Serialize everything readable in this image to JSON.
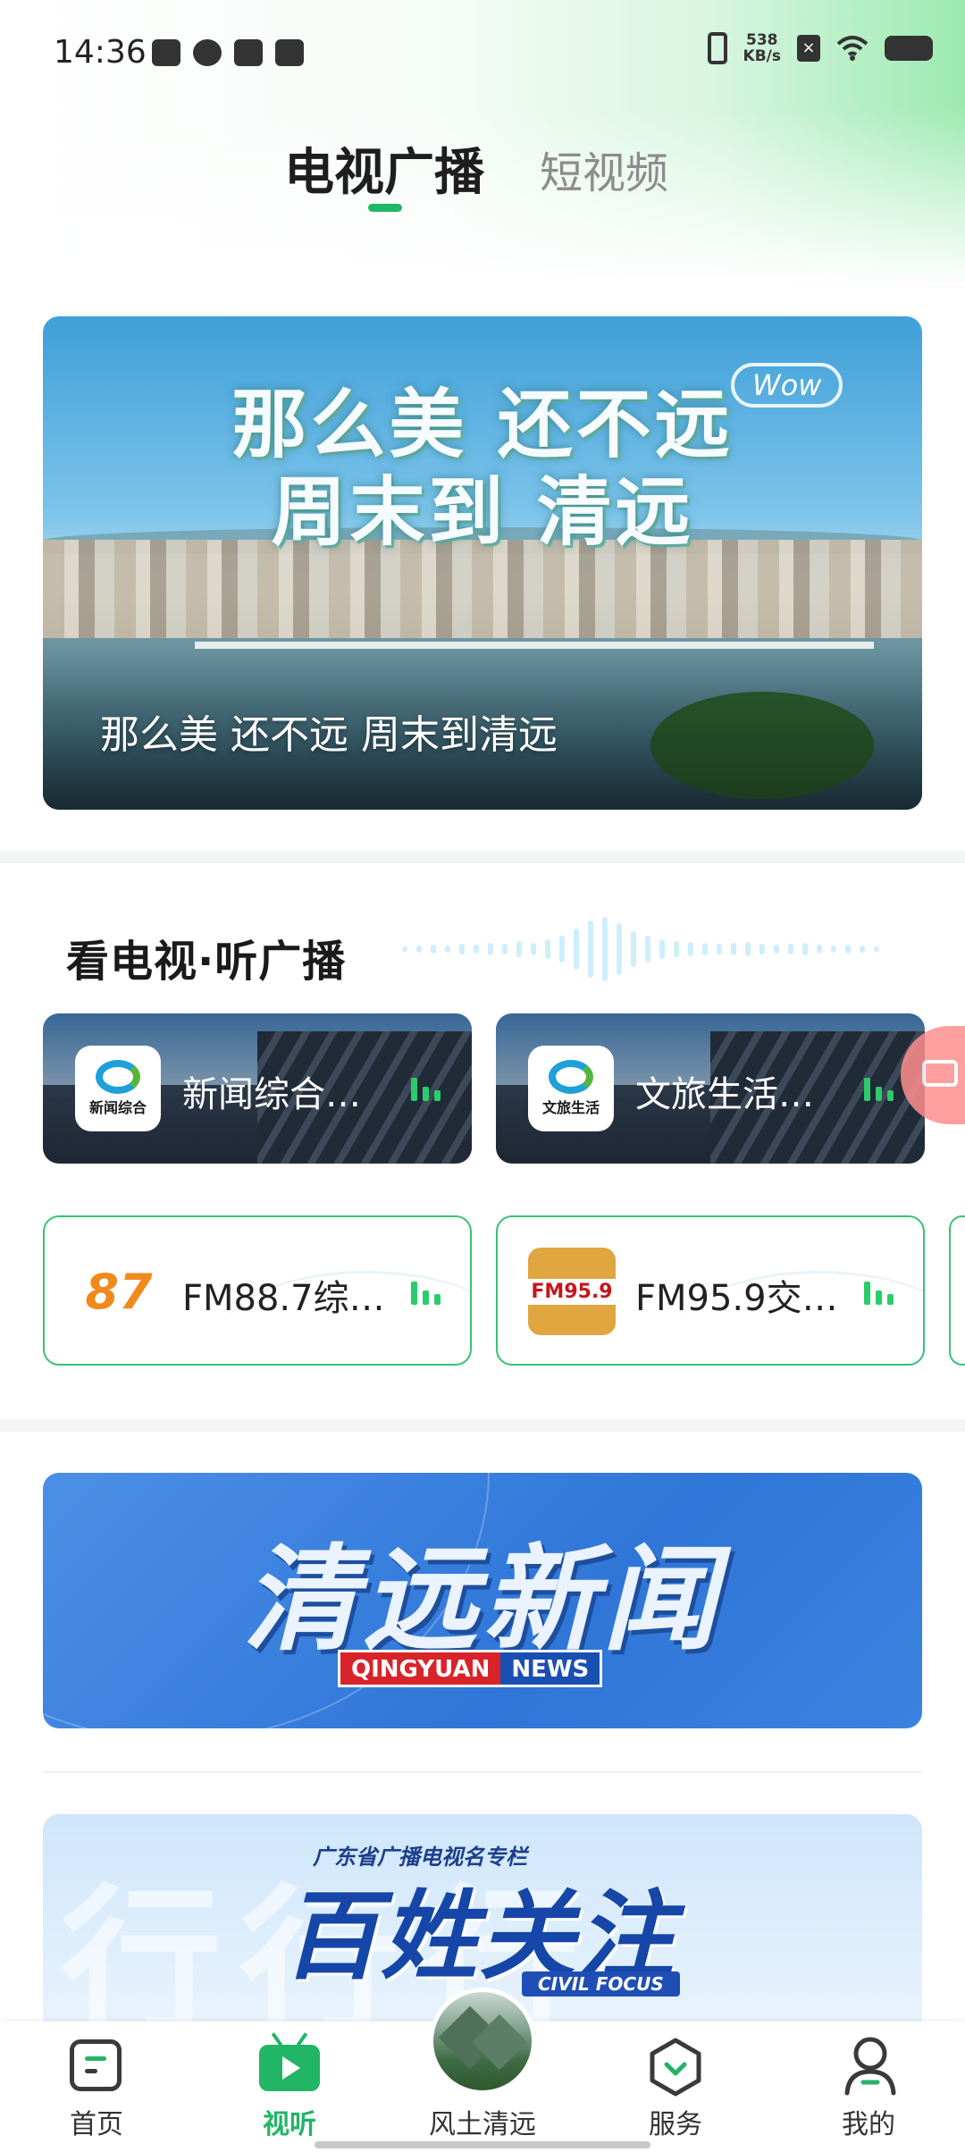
{
  "status_bar": {
    "time": "14:36",
    "net_speed_value": "538",
    "net_speed_unit": "KB/s",
    "x_badge": "×"
  },
  "header": {
    "tabs": [
      {
        "label": "电视广播",
        "active": true
      },
      {
        "label": "短视频",
        "active": false
      }
    ]
  },
  "hero": {
    "headline_line1": "那么美 还不远",
    "headline_line2": "周末到 清远",
    "badge": "Wow",
    "caption": "那么美 还不远 周末到清远"
  },
  "live_section": {
    "title": "看电视·听广播",
    "tv_channels": [
      {
        "logo_text": "新闻综合",
        "name": "新闻综合…"
      },
      {
        "logo_text": "文旅生活",
        "name": "文旅生活…"
      }
    ],
    "radio_channels": [
      {
        "logo_text": "87",
        "name": "FM88.7综…"
      },
      {
        "logo_text": "FM95.9",
        "name": "FM95.9交…"
      }
    ]
  },
  "news_banner": {
    "title": "清远新闻",
    "sub_left": "QINGYUAN",
    "sub_right": "NEWS"
  },
  "focus_banner": {
    "top": "广东省广播电视名专栏",
    "title": "百姓关注",
    "sub": "CIVIL FOCUS"
  },
  "bottom_nav": [
    {
      "label": "首页",
      "icon": "home-icon",
      "active": false
    },
    {
      "label": "视听",
      "icon": "tv-icon",
      "active": true
    },
    {
      "label": "风土清远",
      "icon": "landscape-icon",
      "active": false
    },
    {
      "label": "服务",
      "icon": "service-icon",
      "active": false
    },
    {
      "label": "我的",
      "icon": "profile-icon",
      "active": false
    }
  ],
  "colors": {
    "accent": "#21b566",
    "news_blue": "#2f76d8"
  }
}
